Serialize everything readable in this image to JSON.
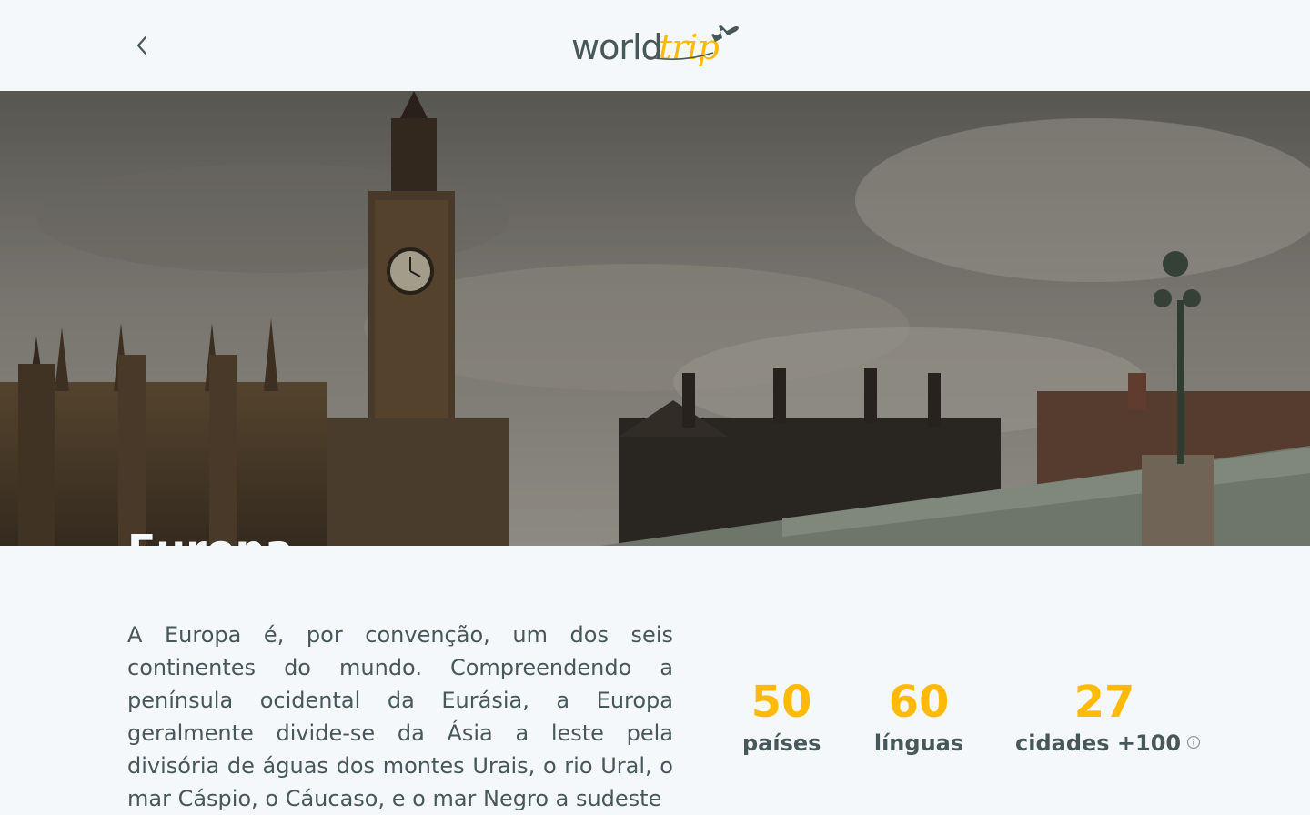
{
  "header": {
    "back_icon": "chevron-left-icon",
    "logo_world": "world",
    "logo_trip": "trip"
  },
  "hero": {
    "title": "Europa"
  },
  "content": {
    "description": "A Europa é, por convenção, um dos seis continentes do mundo. Compreendendo a península ocidental da Eurásia, a Europa geralmente divide-se da Ásia a leste pela divisória de águas dos montes Urais, o rio Ural, o mar Cáspio, o Cáucaso, e o mar Negro a sudeste"
  },
  "stats": [
    {
      "value": "50",
      "label": "países"
    },
    {
      "value": "60",
      "label": "línguas"
    },
    {
      "value": "27",
      "label": "cidades +100",
      "icon": "info-icon"
    }
  ],
  "colors": {
    "accent": "#ffba08",
    "text": "#47585b",
    "background": "#f5f8fa"
  }
}
